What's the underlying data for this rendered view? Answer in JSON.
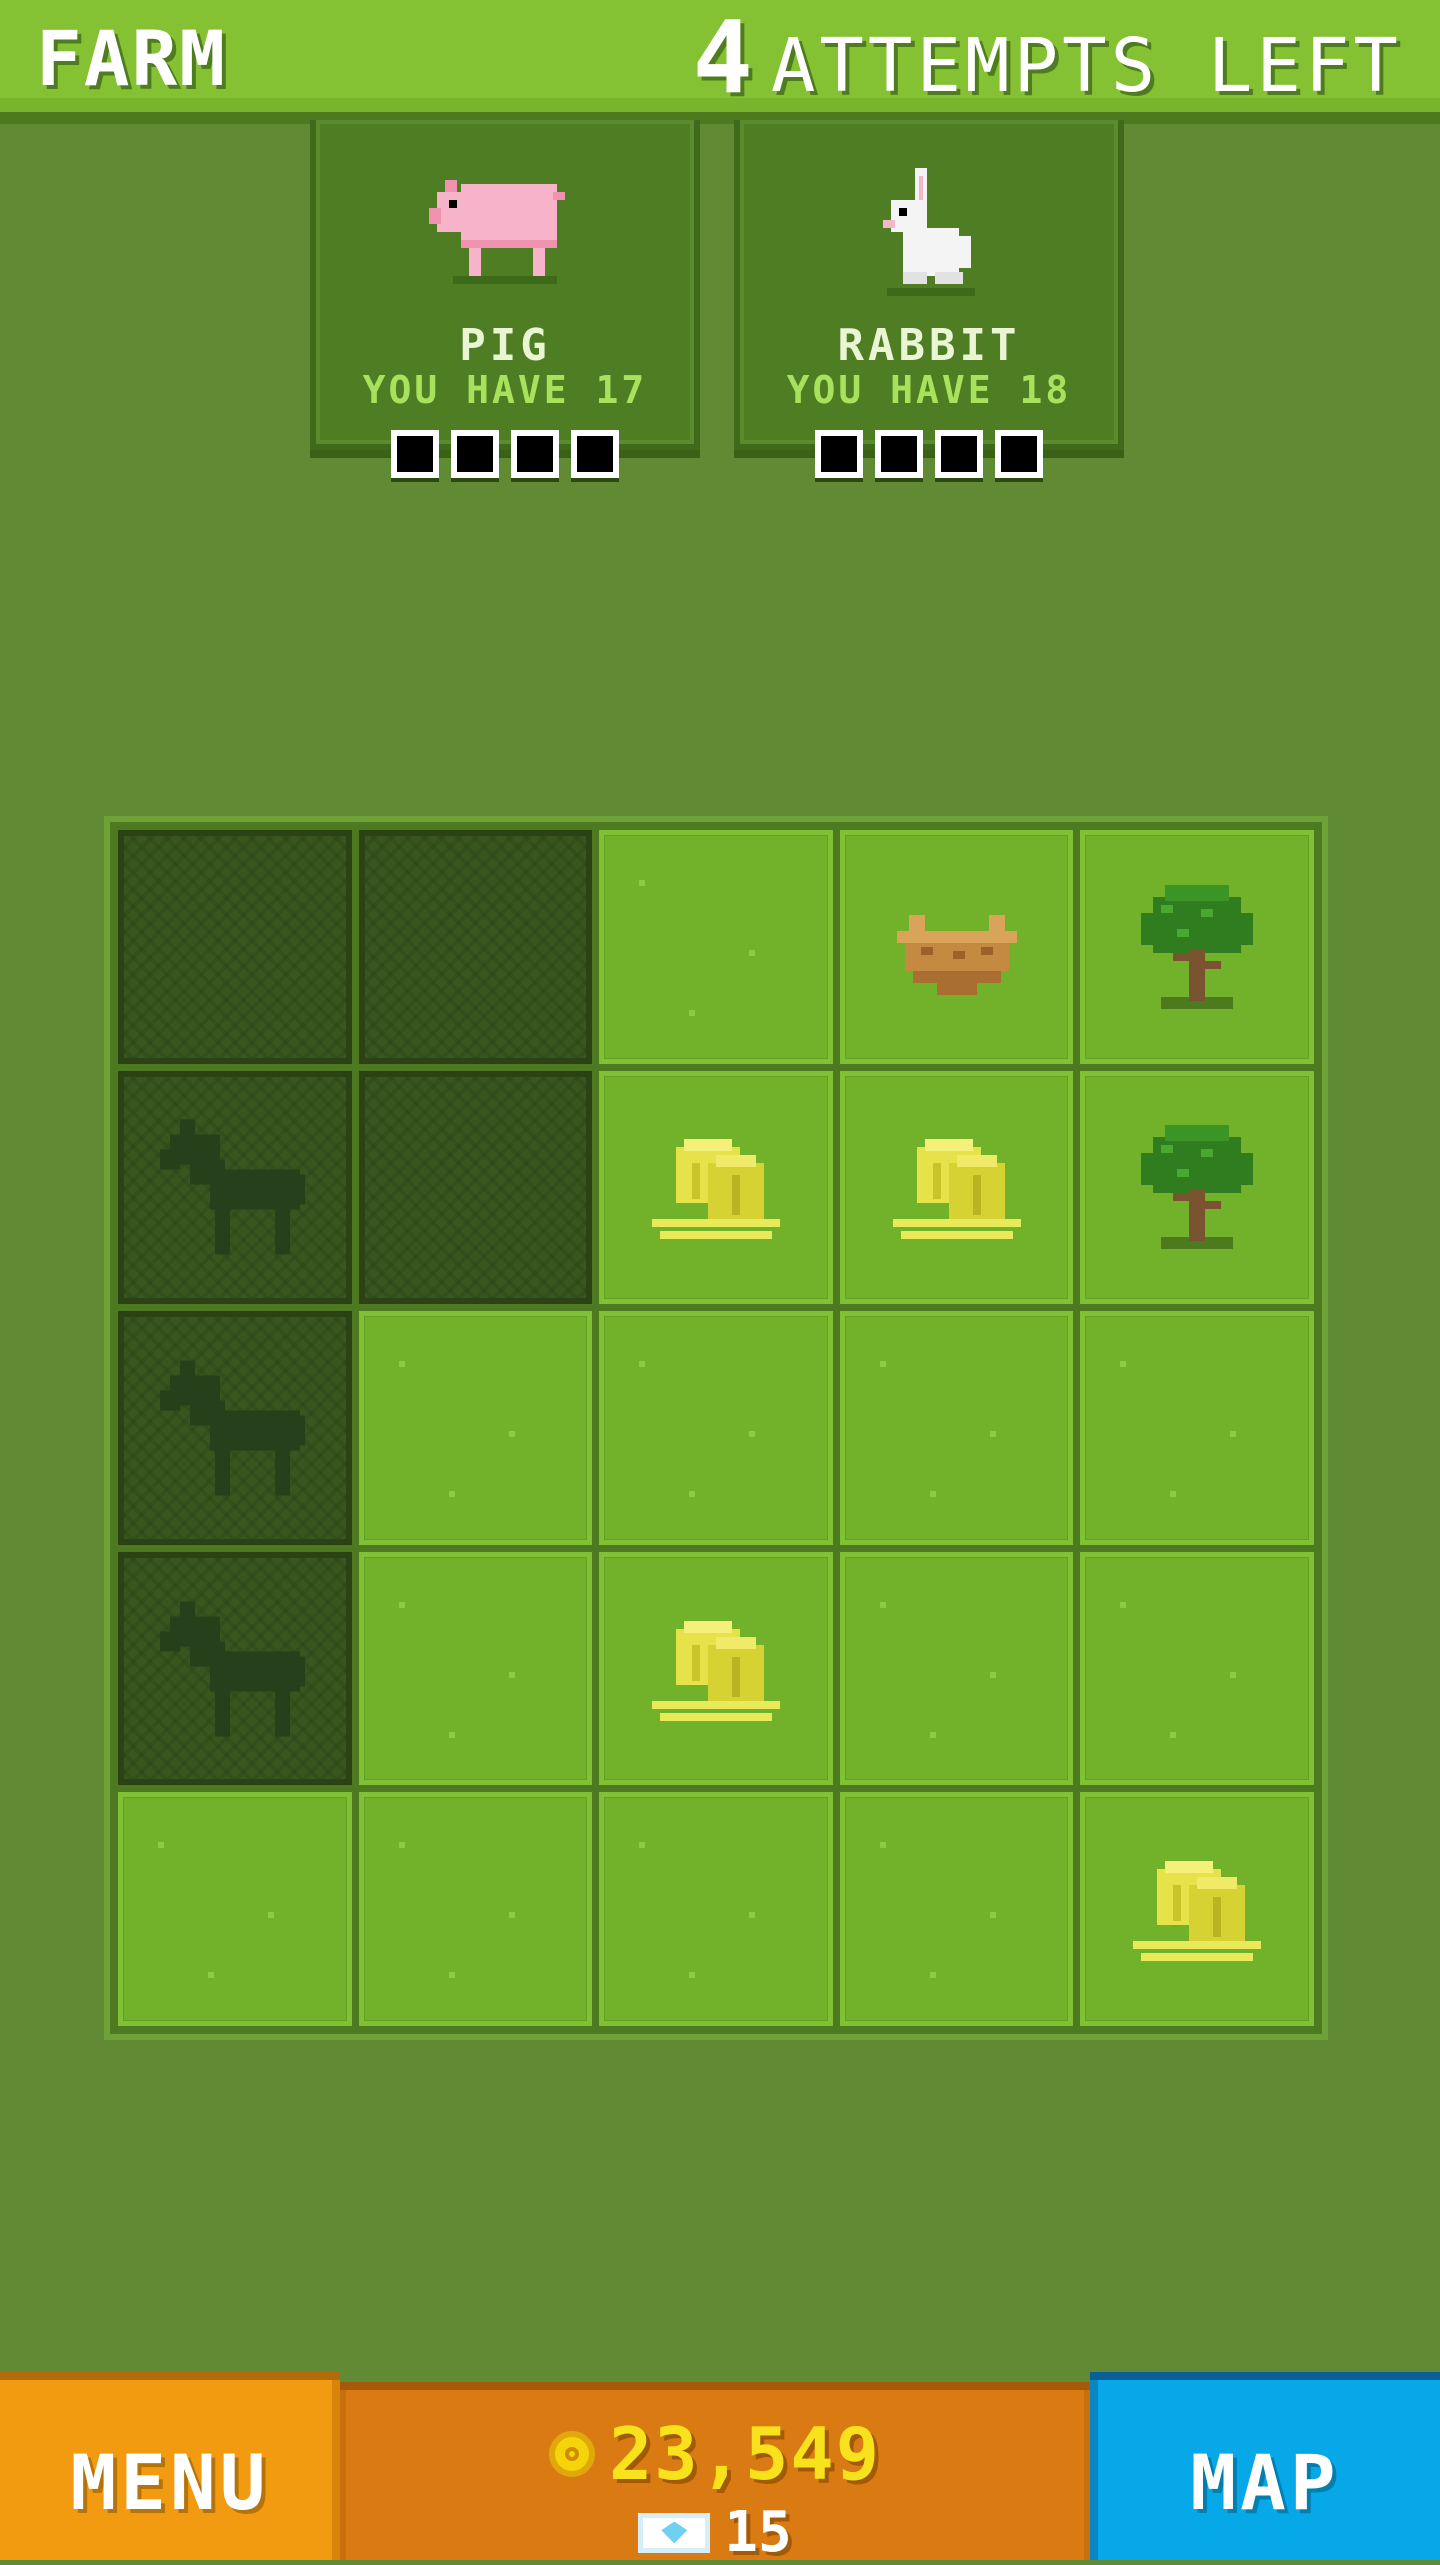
{
  "header": {
    "title": "FARM",
    "attempts_count": "4",
    "attempts_label": "ATTEMPTS LEFT"
  },
  "goals": [
    {
      "name": "PIG",
      "have": "YOU HAVE 17",
      "icon": "pig-icon",
      "slots_filled": 0,
      "slots_total": 4
    },
    {
      "name": "RABBIT",
      "have": "YOU HAVE 18",
      "icon": "rabbit-icon",
      "slots_filled": 0,
      "slots_total": 4
    }
  ],
  "board": {
    "rows": 5,
    "cols": 5,
    "cells": [
      [
        "locked",
        "locked",
        "grass",
        "nest",
        "tree"
      ],
      [
        "locked-horse",
        "locked",
        "hay",
        "hay",
        "tree"
      ],
      [
        "locked-horse",
        "grass",
        "grass",
        "grass",
        "grass"
      ],
      [
        "locked-horse",
        "grass",
        "hay",
        "grass",
        "grass"
      ],
      [
        "grass",
        "grass",
        "grass",
        "grass",
        "hay"
      ]
    ]
  },
  "footer": {
    "menu_label": "MENU",
    "coins": "23,549",
    "gems": "15",
    "map_label": "MAP"
  },
  "colors": {
    "grass": "#72b12a",
    "locked": "#38561d",
    "menu": "#f29a10",
    "map": "#06a8e8",
    "wallet": "#d97a12",
    "coins": "#f8e21c"
  }
}
